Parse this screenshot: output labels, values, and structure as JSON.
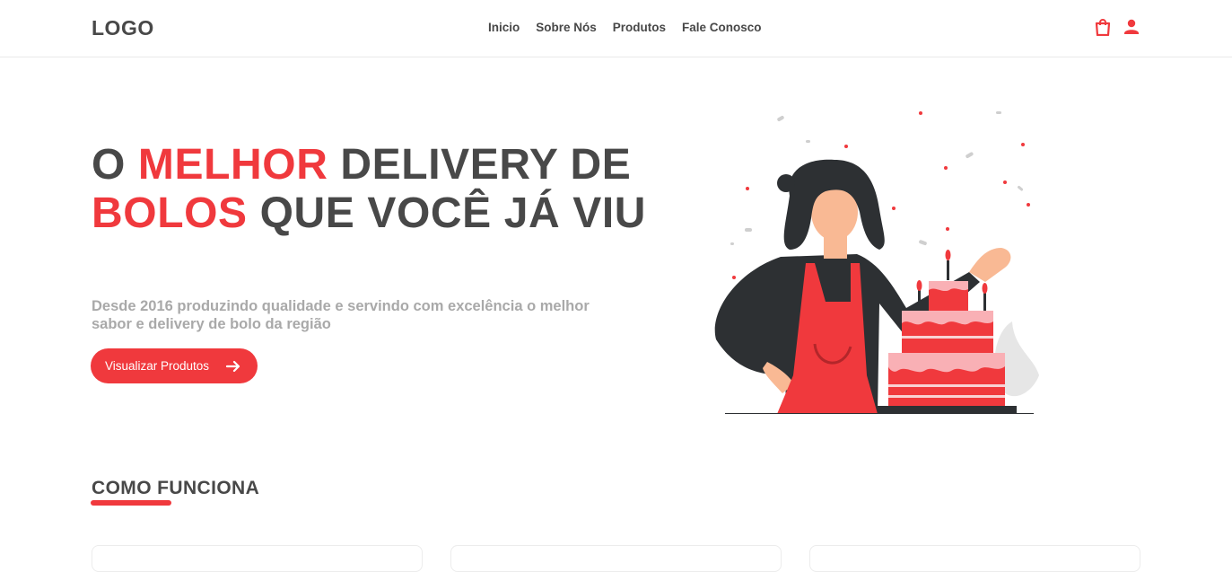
{
  "header": {
    "logo": "LOGO",
    "nav": [
      "Inicio",
      "Sobre Nós",
      "Produtos",
      "Fale Conosco"
    ],
    "icons": [
      "shopping-bag-icon",
      "user-icon"
    ]
  },
  "hero": {
    "title_parts": [
      "O ",
      "MELHOR",
      " DELIVERY DE ",
      "BOLOS",
      " QUE VOCÊ JÁ VIU"
    ],
    "subtitle": "Desde 2016 produzindo qualidade e servindo com excelência o melhor sabor e delivery de bolo da região",
    "cta_label": "Visualizar Produtos"
  },
  "section": {
    "title": "COMO FUNCIONA"
  },
  "colors": {
    "accent": "#f0393d",
    "text": "#484848",
    "muted": "#a9a9a9"
  }
}
